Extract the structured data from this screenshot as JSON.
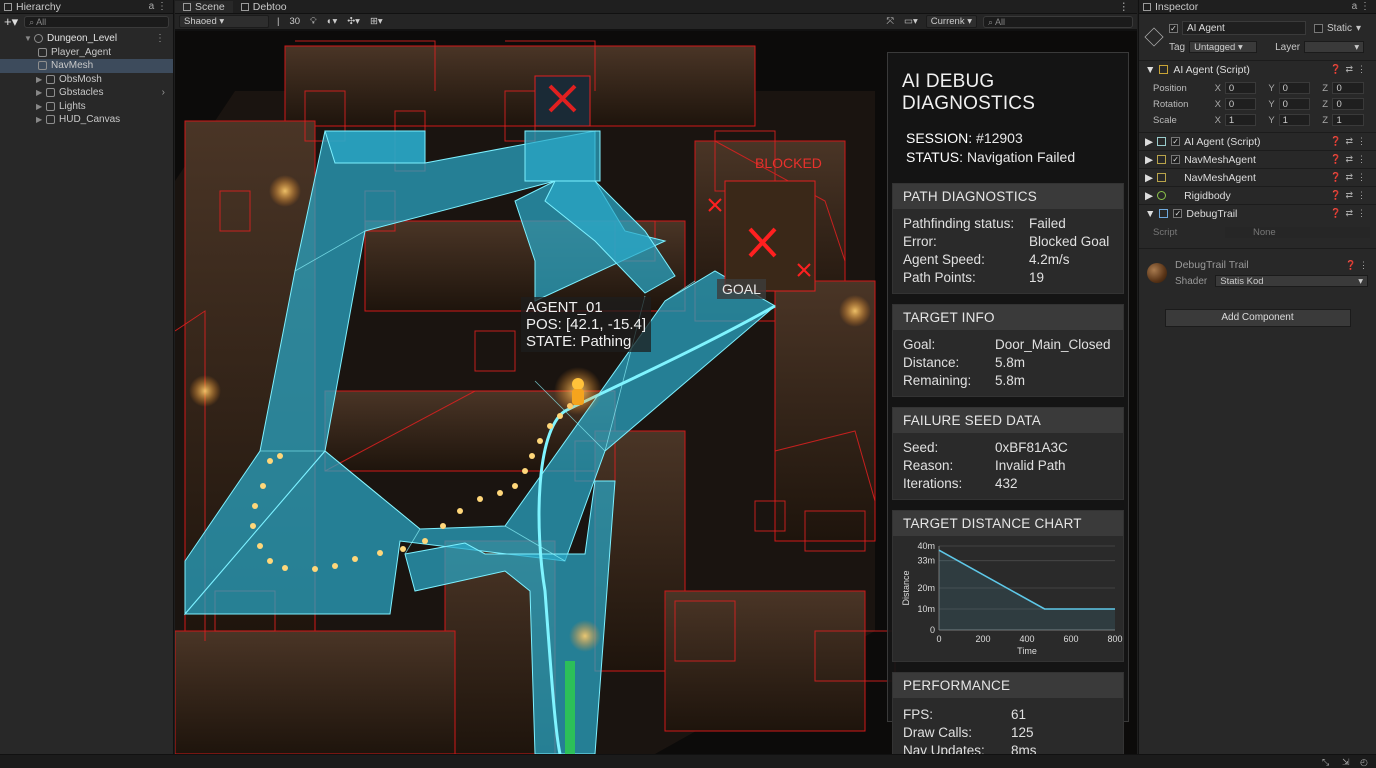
{
  "hierarchy": {
    "tab_label": "Hierarchy",
    "search_placeholder": "All",
    "items": [
      {
        "label": "Dungeon_Level",
        "root": true
      },
      {
        "label": "Player_Agent"
      },
      {
        "label": "NavMesh",
        "selected": true
      },
      {
        "label": "ObsMosh"
      },
      {
        "label": "Gbstacles"
      },
      {
        "label": "Lights"
      },
      {
        "label": "HUD_Canvas"
      }
    ]
  },
  "scene": {
    "tabs": [
      "Scene",
      "Debtoo"
    ],
    "shading_mode": "Shaoed",
    "zoom_value": "30",
    "camera_dropdown": "Currenk",
    "search_placeholder": "All",
    "overlay": {
      "blocked_label": "BLOCKED",
      "goal_label": "GOAL",
      "agent_name": "AGENT_01",
      "agent_pos": "POS: [42.1, -15.4]",
      "agent_state": "STATE: Pathing"
    }
  },
  "debug_panel": {
    "title": "AI DEBUG DIAGNOSTICS",
    "session_label": "SESSION:",
    "session_value": "#12903",
    "status_label": "STATUS:",
    "status_value": "Navigation Failed",
    "path": {
      "header": "PATH DIAGNOSTICS",
      "rows": [
        {
          "k": "Pathfinding status:",
          "v": "Failed"
        },
        {
          "k": "Error:",
          "v": "Blocked Goal"
        },
        {
          "k": "Agent Speed:",
          "v": "4.2m/s"
        },
        {
          "k": "Path Points:",
          "v": "19"
        }
      ]
    },
    "target": {
      "header": "TARGET INFO",
      "rows": [
        {
          "k": "Goal:",
          "v": "Door_Main_Closed"
        },
        {
          "k": "Distance:",
          "v": "5.8m"
        },
        {
          "k": "Remaining:",
          "v": "5.8m"
        }
      ]
    },
    "seed": {
      "header": "FAILURE SEED DATA",
      "rows": [
        {
          "k": "Seed:",
          "v": "0xBF81A3C"
        },
        {
          "k": "Reason:",
          "v": "Invalid Path"
        },
        {
          "k": "Iterations:",
          "v": "432"
        }
      ]
    },
    "chart_header": "TARGET DISTANCE CHART",
    "performance": {
      "header": "PERFORMANCE",
      "rows": [
        {
          "k": "FPS:",
          "v": "61"
        },
        {
          "k": "Draw Calls:",
          "v": "125"
        },
        {
          "k": "Nav Updates:",
          "v": "8ms"
        }
      ]
    }
  },
  "chart_data": {
    "type": "line",
    "title": "TARGET DISTANCE CHART",
    "xlabel": "Time",
    "ylabel": "Distance",
    "x_ticks": [
      "0",
      "200",
      "400",
      "600",
      "800"
    ],
    "y_ticks": [
      "0",
      "10m",
      "20m",
      "33m",
      "40m"
    ],
    "xlim": [
      0,
      800
    ],
    "ylim": [
      0,
      40
    ],
    "series": [
      {
        "x": [
          0,
          480,
          800
        ],
        "y": [
          38,
          10,
          10
        ]
      }
    ],
    "grid": true,
    "color": "#5ec8e8"
  },
  "inspector": {
    "tab_label": "Inspector",
    "object_name": "AI Agent",
    "static_label": "Static",
    "tag_label": "Tag",
    "tag_value": "Untagged",
    "layer_label": "Layer",
    "transform_header": "AI Agent (Script)",
    "transform": [
      {
        "label": "Position",
        "x": "0",
        "y": "0",
        "z": "0"
      },
      {
        "label": "Rotation",
        "x": "0",
        "y": "0",
        "z": "0"
      },
      {
        "label": "Scale",
        "x": "1",
        "y": "1",
        "z": "1"
      }
    ],
    "components": [
      {
        "label": "AI Agent (Script)",
        "checked": true
      },
      {
        "label": "NavMeshAgent",
        "checked": true
      },
      {
        "label": "NavMeshAgent",
        "checked": false
      },
      {
        "label": "Rigidbody",
        "checked": false
      },
      {
        "label": "DebugTrail",
        "checked": true
      }
    ],
    "script_label": "Script",
    "script_value": "None",
    "material_name": "DebugTrail Trail",
    "shader_label": "Shader",
    "shader_value": "Statis Kod",
    "add_component": "Add Component"
  }
}
